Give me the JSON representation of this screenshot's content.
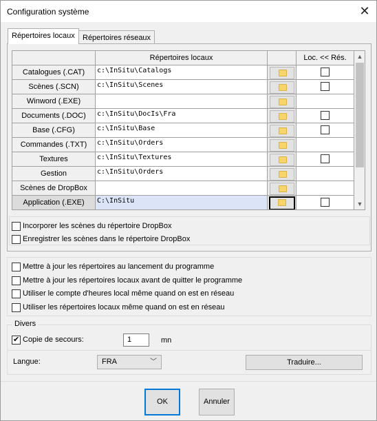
{
  "window": {
    "title": "Configuration système",
    "close_glyph": "✕"
  },
  "tabs": [
    {
      "label": "Répertoires locaux",
      "active": true
    },
    {
      "label": "Répertoires réseaux",
      "active": false
    }
  ],
  "grid": {
    "headers": {
      "directories": "Répertoires locaux",
      "loc_res": "Loc. << Rés."
    },
    "rows": [
      {
        "label": "Catalogues (.CAT)",
        "path": "c:\\InSitu\\Catalogs",
        "checkbox": true
      },
      {
        "label": "Scènes (.SCN)",
        "path": "c:\\InSitu\\Scenes",
        "checkbox": true
      },
      {
        "label": "Winword (.EXE)",
        "path": "",
        "checkbox": false
      },
      {
        "label": "Documents (.DOC)",
        "path": "c:\\InSitu\\DocIs\\Fra",
        "checkbox": true
      },
      {
        "label": "Base (.CFG)",
        "path": "c:\\InSitu\\Base",
        "checkbox": true
      },
      {
        "label": "Commandes (.TXT)",
        "path": "c:\\InSitu\\Orders",
        "checkbox": false
      },
      {
        "label": "Textures",
        "path": "c:\\InSitu\\Textures",
        "checkbox": true
      },
      {
        "label": "Gestion",
        "path": "c:\\InSitu\\Orders",
        "checkbox": false
      },
      {
        "label": "Scènes de DropBox",
        "path": "",
        "checkbox": false
      },
      {
        "label": "Application (.EXE)",
        "path": "C:\\InSitu",
        "checkbox": true,
        "selected": true
      }
    ],
    "scroll_up_glyph": "▲",
    "scroll_down_glyph": "▼"
  },
  "dropbox_options": {
    "incorporate": {
      "label": "Incorporer les scènes du répertoire DropBox",
      "checked": false
    },
    "save": {
      "label": "Enregistrer les scènes dans le répertoire DropBox",
      "checked": false
    }
  },
  "update_options": [
    {
      "label": "Mettre à jour les répertoires au lancement du programme",
      "checked": false
    },
    {
      "label": "Mettre à jour les répertoires locaux avant de quitter le programme",
      "checked": false
    },
    {
      "label": "Utiliser le compte d'heures local même quand on est en réseau",
      "checked": false
    },
    {
      "label": "Utiliser les répertoires locaux même quand on est en réseau",
      "checked": false
    }
  ],
  "divers": {
    "group_label": "Divers",
    "backup": {
      "label": "Copie de secours:",
      "checked": true,
      "value": "1",
      "unit": "mn"
    },
    "language": {
      "label": "Langue:",
      "value": "FRA",
      "chevron": "﹀"
    },
    "translate_button": "Traduire..."
  },
  "footer": {
    "ok": "OK",
    "cancel": "Annuler"
  },
  "colors": {
    "accent": "#0078d7",
    "selected_row": "#dbe5f7",
    "folder": "#f7d56a"
  }
}
